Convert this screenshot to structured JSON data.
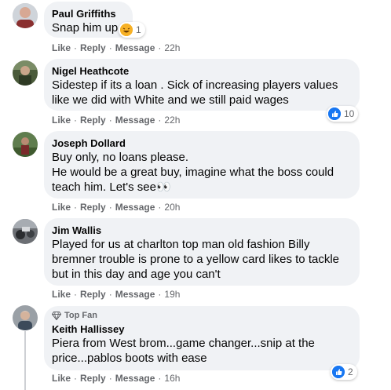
{
  "actions": {
    "like": "Like",
    "reply": "Reply",
    "message": "Message",
    "sep": "·"
  },
  "colors": {
    "bubble": "#f0f2f5",
    "like_blue": "#1877f2",
    "muted": "#65676b"
  },
  "comments": [
    {
      "author": "Paul Griffiths",
      "text": "Snap him up",
      "time": "22h",
      "reaction": {
        "type": "haha-icon",
        "count": "1"
      }
    },
    {
      "author": "Nigel Heathcote",
      "text": "Sidestep if its a loan . Sick of increasing players values\nlike we did with White and we still paid wages",
      "time": "22h",
      "reaction": {
        "type": "like-icon",
        "count": "10"
      }
    },
    {
      "author": "Joseph Dollard",
      "text": "Buy only, no loans please.\nHe would be a great buy, imagine what the boss could\nteach him. Let's see",
      "emoji": "👀",
      "time": "20h"
    },
    {
      "author": "Jim Wallis",
      "text": "Played for us at charlton top man old fashion Billy\nbremner trouble is prone to a yellow card likes to tackle\nbut in this day and age you can't",
      "time": "19h"
    },
    {
      "author": "Keith Hallissey",
      "badge": "Top Fan",
      "text": "Piera from West brom...game changer...snip at the\nprice...pablos boots with ease",
      "time": "16h",
      "reaction": {
        "type": "like-icon",
        "count": "2"
      }
    }
  ]
}
